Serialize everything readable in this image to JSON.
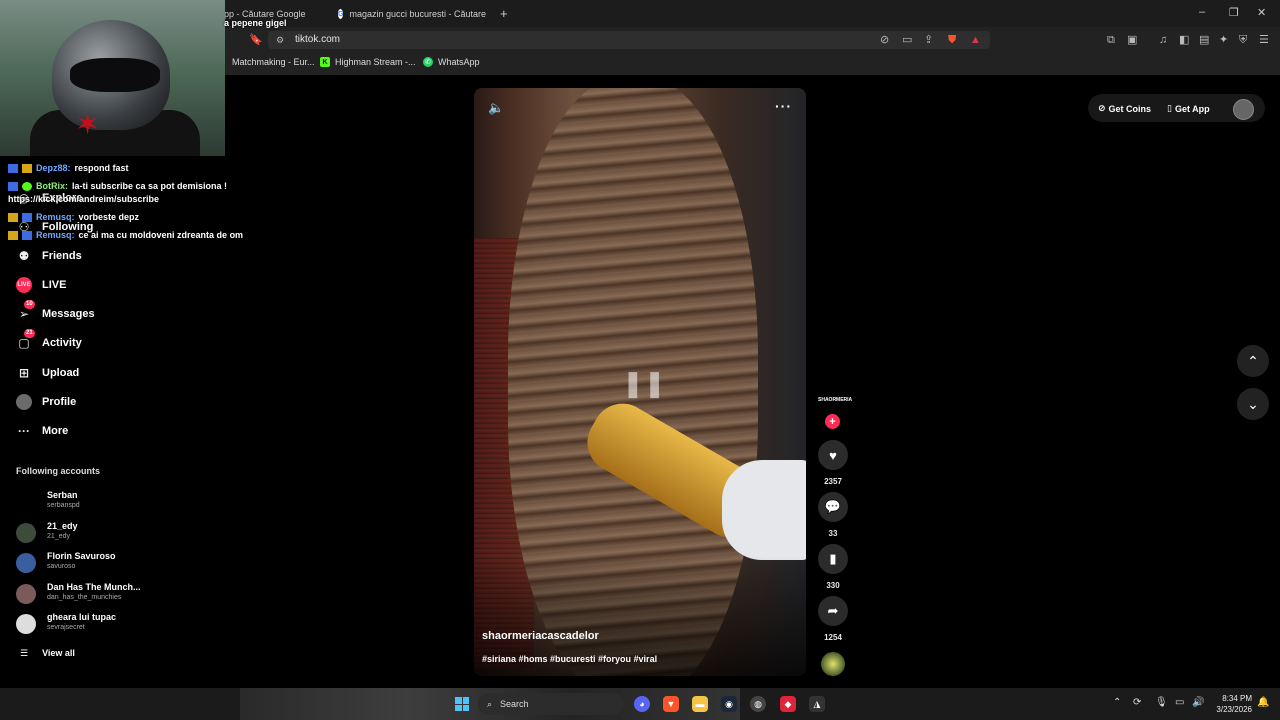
{
  "browser": {
    "tabs": [
      {
        "label": "pp - Căutare Google"
      },
      {
        "label": "magazin gucci bucuresti - Căutare Go"
      }
    ],
    "new_tab": "+",
    "window_controls": [
      "–",
      "❐",
      "✕"
    ],
    "url": "tiktok.com",
    "bookmarks": [
      {
        "label": "Matchmaking - Eur..."
      },
      {
        "label": "Highman Stream -..."
      },
      {
        "label": "WhatsApp"
      }
    ]
  },
  "chat": {
    "top_line": "a pepene gigel",
    "messages": [
      {
        "user": "Depz88:",
        "text": "respond fast"
      },
      {
        "user": "BotRix:",
        "text": "la-ti subscribe ca sa pot demisiona !"
      },
      {
        "user": "",
        "text": "https://kick.com/andreim/subscribe"
      },
      {
        "user": "Remusq:",
        "text": "vorbeste depz"
      },
      {
        "user": "Remusq:",
        "text": "ce ai ma cu moldoveni zdreanta de om"
      }
    ]
  },
  "sidebar": {
    "items": [
      {
        "label": "Explore",
        "icon": "compass-icon"
      },
      {
        "label": "Following",
        "icon": "following-icon"
      },
      {
        "label": "Friends",
        "icon": "friends-icon"
      },
      {
        "label": "LIVE",
        "icon": "live-icon"
      },
      {
        "label": "Messages",
        "icon": "messages-icon",
        "badge": "10"
      },
      {
        "label": "Activity",
        "icon": "activity-icon",
        "badge": "21"
      },
      {
        "label": "Upload",
        "icon": "upload-icon"
      },
      {
        "label": "Profile",
        "icon": "profile-avatar"
      },
      {
        "label": "More",
        "icon": "more-icon"
      }
    ],
    "following_heading": "Following accounts",
    "accounts": [
      {
        "name": "Serban",
        "handle": "serbanspd"
      },
      {
        "name": "21_edy",
        "handle": "21_edy"
      },
      {
        "name": "Florin Savuroso",
        "handle": "savuroso"
      },
      {
        "name": "Dan Has The Munch...",
        "handle": "dan_has_the_munchies"
      },
      {
        "name": "gheara lui tupac",
        "handle": "sevrajsecret"
      }
    ],
    "view_all": "View all"
  },
  "video": {
    "author": "shaormeriacascadelor",
    "hashtags": "#siriana #homs #bucuresti #foryou #viral",
    "creator_badge": "SHAORMERIA",
    "likes": "2357",
    "comments": "33",
    "saves": "330",
    "shares": "1254"
  },
  "header": {
    "get_coins": "Get Coins",
    "get_app": "Get App"
  },
  "taskbar": {
    "search": "Search",
    "time": "8:34 PM",
    "date": "3/23/2026"
  },
  "colors": {
    "accent": "#fe2c55",
    "background": "#000000",
    "chrome": "#222222"
  }
}
